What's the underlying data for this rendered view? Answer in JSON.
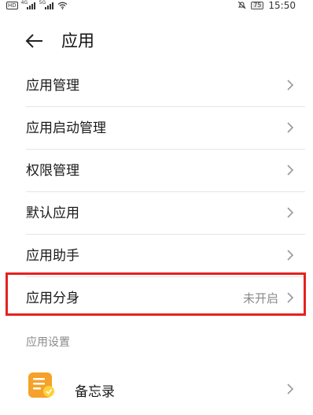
{
  "status_bar": {
    "hd_badge": "HD",
    "network_1": "4G",
    "network_2": "5G",
    "battery": "75",
    "time": "15:50"
  },
  "header": {
    "title": "应用",
    "back_icon": "arrow-left-icon"
  },
  "settings_list": {
    "items": [
      {
        "label": "应用管理",
        "value": ""
      },
      {
        "label": "应用启动管理",
        "value": ""
      },
      {
        "label": "权限管理",
        "value": ""
      },
      {
        "label": "默认应用",
        "value": ""
      },
      {
        "label": "应用助手",
        "value": ""
      },
      {
        "label": "应用分身",
        "value": "未开启",
        "highlighted": true
      }
    ]
  },
  "app_settings": {
    "section_title": "应用设置",
    "apps": [
      {
        "label": "备忘录",
        "icon": "notes-app-icon"
      }
    ]
  },
  "colors": {
    "highlight_border": "#e5221f",
    "secondary_text": "#8a8a8a",
    "divider": "#e5e5e5",
    "notes_icon_orange": "#f5a12a"
  }
}
